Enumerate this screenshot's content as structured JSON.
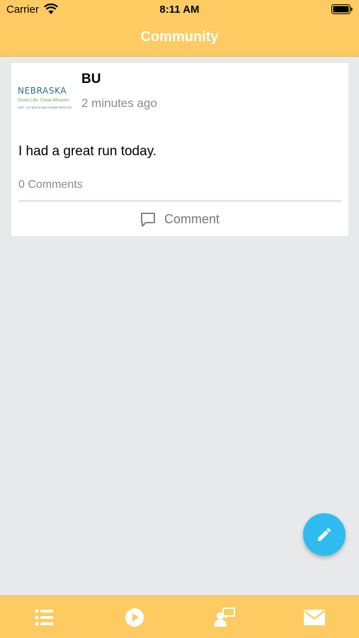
{
  "status_bar": {
    "carrier": "Carrier",
    "time": "8:11 AM",
    "icons": [
      "wifi-icon",
      "battery-icon"
    ]
  },
  "header": {
    "title": "Community",
    "background_color": "#fdcb62"
  },
  "post": {
    "logo": {
      "name": "NEBRASKA",
      "tagline": "Good Life. Great Mission.",
      "department": "DEPT. OF HEALTH AND HUMAN SERVICES"
    },
    "author": "BU",
    "timestamp": "2 minutes ago",
    "text": "I had a great run today.",
    "comment_count": "0 Comments",
    "comment_button_label": "Comment",
    "comment_icon": "comment-icon"
  },
  "fab": {
    "icon": "pencil-icon",
    "color": "#2ebcf0"
  },
  "tab_bar": {
    "background_color": "#fdcb62",
    "tabs": [
      {
        "icon": "list-icon"
      },
      {
        "icon": "play-icon"
      },
      {
        "icon": "community-icon"
      },
      {
        "icon": "mail-icon"
      }
    ]
  }
}
